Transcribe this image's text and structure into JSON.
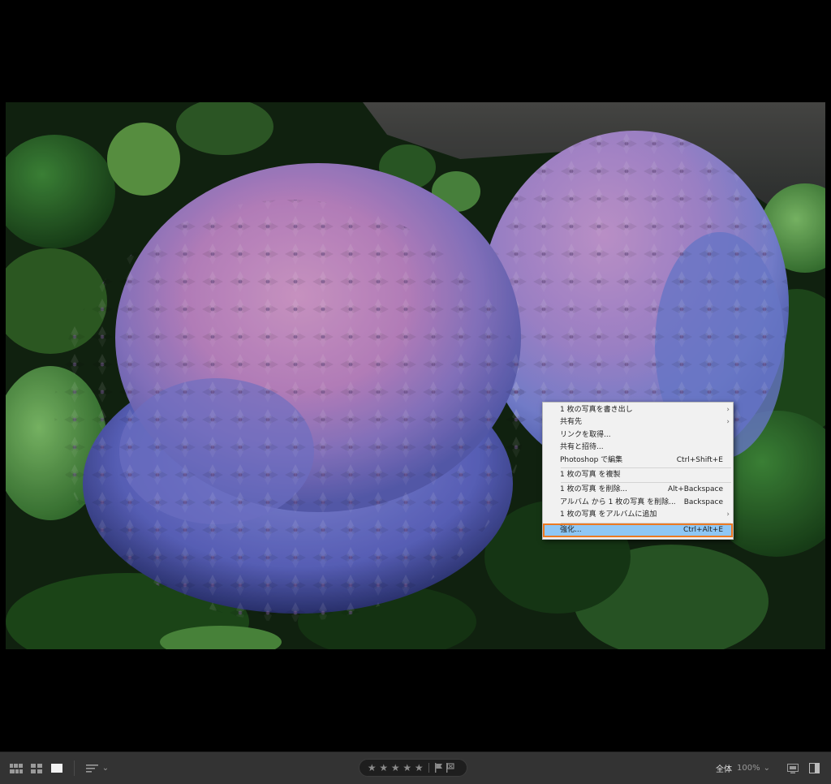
{
  "context_menu": {
    "items": [
      {
        "label": "1 枚の写真を書き出し",
        "shortcut": "",
        "submenu": true
      },
      {
        "label": "共有先",
        "shortcut": "",
        "submenu": true
      },
      {
        "label": "リンクを取得...",
        "shortcut": "",
        "submenu": false
      },
      {
        "label": "共有と招待...",
        "shortcut": "",
        "submenu": false
      },
      {
        "label": "Photoshop で編集",
        "shortcut": "Ctrl+Shift+E",
        "submenu": false
      },
      {
        "label": "1 枚の写真 を複製",
        "shortcut": "",
        "submenu": false
      },
      {
        "label": "1 枚の写真 を削除...",
        "shortcut": "Alt+Backspace",
        "submenu": false
      },
      {
        "label": "アルバム から 1 枚の写真 を削除...",
        "shortcut": "Backspace",
        "submenu": false
      },
      {
        "label": "1 枚の写真 をアルバムに追加",
        "shortcut": "",
        "submenu": true
      },
      {
        "label": "強化...",
        "shortcut": "Ctrl+Alt+E",
        "submenu": false,
        "highlighted": true
      }
    ],
    "submenu_glyph": "›"
  },
  "toolbar": {
    "star_glyph": "★",
    "rating_stars": 0,
    "zoom_label": "全体",
    "zoom_value": "100%",
    "zoom_chevron": "⌄",
    "sort_chevron": "⌄"
  },
  "colors": {
    "menu_background": "#f1f1f1",
    "menu_highlight": "#8ec7f5",
    "menu_highlight_border": "#ec7a22",
    "toolbar_background": "#333333"
  },
  "icons": {
    "grid_view": "grid-icon",
    "square_grid_view": "square-grid-icon",
    "detail_view": "detail-view-icon",
    "sort": "sort-icon",
    "flag_pick": "flag-icon",
    "flag_reject": "reject-flag-icon",
    "compare": "compare-icon",
    "panel_toggle": "panel-toggle-icon"
  }
}
